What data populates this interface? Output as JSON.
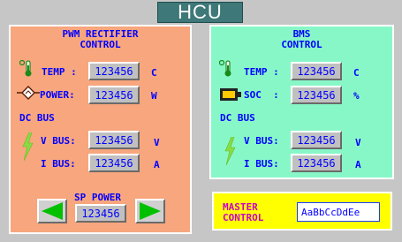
{
  "title": "HCU",
  "pwm": {
    "heading_line1": "PWM RECTIFIER",
    "heading_line2": "CONTROL",
    "temp_label": "TEMP :",
    "temp_value": "123456",
    "temp_unit": "C",
    "power_label": "POWER:",
    "power_value": "123456",
    "power_unit": "W",
    "dcbus_label": "DC BUS",
    "vbus_label": "V BUS:",
    "vbus_value": "123456",
    "vbus_unit": "V",
    "ibus_label": "I BUS:",
    "ibus_value": "123456",
    "ibus_unit": "A",
    "sp_power_label": "SP POWER",
    "sp_power_value": "123456"
  },
  "bms": {
    "heading_line1": "BMS",
    "heading_line2": "CONTROL",
    "temp_label": "TEMP :",
    "temp_value": "123456",
    "temp_unit": "C",
    "soc_label": "SOC  :",
    "soc_value": "123456",
    "soc_unit": "%",
    "dcbus_label": "DC BUS",
    "vbus_label": "V BUS:",
    "vbus_value": "123456",
    "vbus_unit": "V",
    "ibus_label": "I BUS:",
    "ibus_value": "123456",
    "ibus_unit": "A"
  },
  "master": {
    "label_line1": "MASTER",
    "label_line2": "CONTROL",
    "input_value": "AaBbCcDdEe"
  },
  "icons": {
    "thermometer": "thermometer-icon",
    "power": "power-icon",
    "lightning": "lightning-icon",
    "battery": "battery-icon",
    "arrow_left": "arrow-left-icon",
    "arrow_right": "arrow-right-icon"
  },
  "colors": {
    "title_bg": "#3e7878",
    "pwm_panel": "#f7a67e",
    "bms_panel": "#88f7c8",
    "master_panel": "#ffff00",
    "text_blue": "#0000ff",
    "master_text": "#cc00cc",
    "arrow_green": "#00c000"
  }
}
